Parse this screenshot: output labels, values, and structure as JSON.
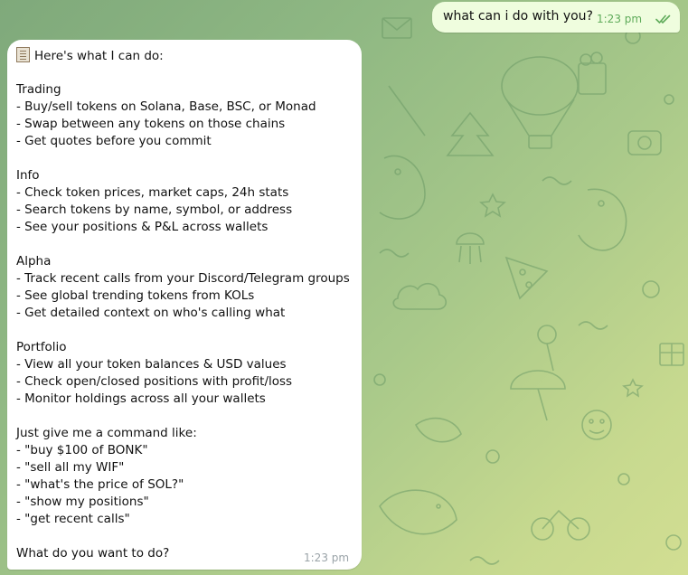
{
  "outgoing": {
    "text": "what can i do with you?",
    "time": "1:23 pm"
  },
  "incoming": {
    "header": "Here's what I can do:",
    "header_icon": "clipboard-icon",
    "lines": [
      "Trading",
      "- Buy/sell tokens on Solana, Base, BSC, or Monad",
      "- Swap between any tokens on those chains",
      "- Get quotes before you commit",
      "Info",
      "- Check token prices, market caps, 24h stats",
      "- Search tokens by name, symbol, or address",
      "- See your positions & P&L across wallets",
      "Alpha",
      "- Track recent calls from your Discord/Telegram groups",
      "- See global trending tokens from KOLs",
      "- Get detailed context on who's calling what",
      "Portfolio",
      "- View all your token balances & USD values",
      "- Check open/closed positions with profit/loss",
      "- Monitor holdings across all your wallets",
      "Just give me a command like:",
      "- \"buy $100 of BONK\"",
      "- \"sell all my WIF\"",
      "- \"what's the price of SOL?\"",
      "- \"show my positions\"",
      "- \"get recent calls\"",
      "What do you want to do?"
    ],
    "time": "1:23 pm"
  },
  "colors": {
    "outgoing_bubble": "#effdde",
    "incoming_bubble": "#ffffff",
    "read_checks": "#5fab5a",
    "background_start": "#7fa97b",
    "background_end": "#d2de92"
  }
}
